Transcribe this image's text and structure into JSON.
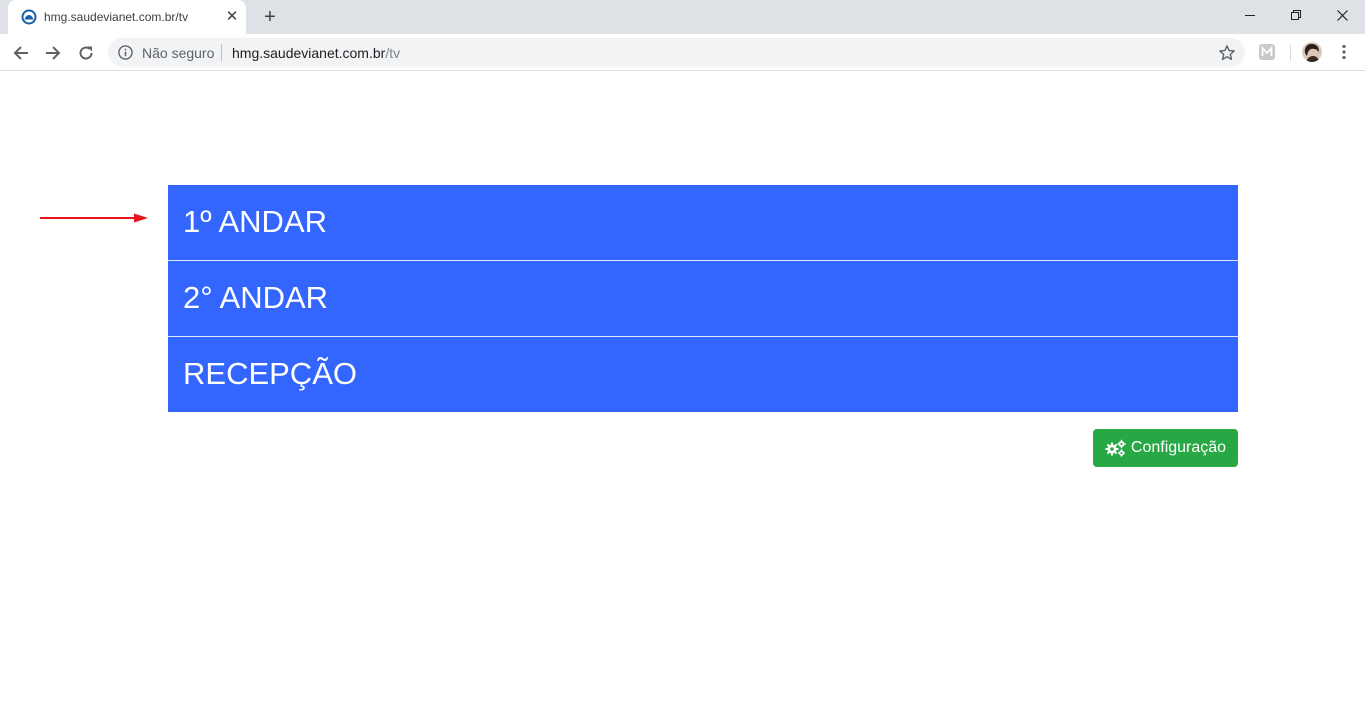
{
  "browser": {
    "tab": {
      "title": "hmg.saudevianet.com.br/tv",
      "close_glyph": "✕"
    },
    "new_tab_glyph": "+",
    "window_controls": {
      "minimize": "minimize-icon",
      "maximize": "restore-icon",
      "close": "close-icon"
    },
    "omnibox": {
      "security_label": "Não seguro",
      "url_host": "hmg.saudevianet.com.br",
      "url_path": "/tv"
    }
  },
  "page": {
    "floors": [
      {
        "label": "1º ANDAR"
      },
      {
        "label": "2° ANDAR"
      },
      {
        "label": "RECEPÇÃO"
      }
    ],
    "config_button": {
      "label": "Configuração",
      "icon": "gears-icon"
    }
  },
  "colors": {
    "floor_background": "#3366ff",
    "config_button": "#28a745",
    "annotation_arrow": "#e8141c"
  }
}
